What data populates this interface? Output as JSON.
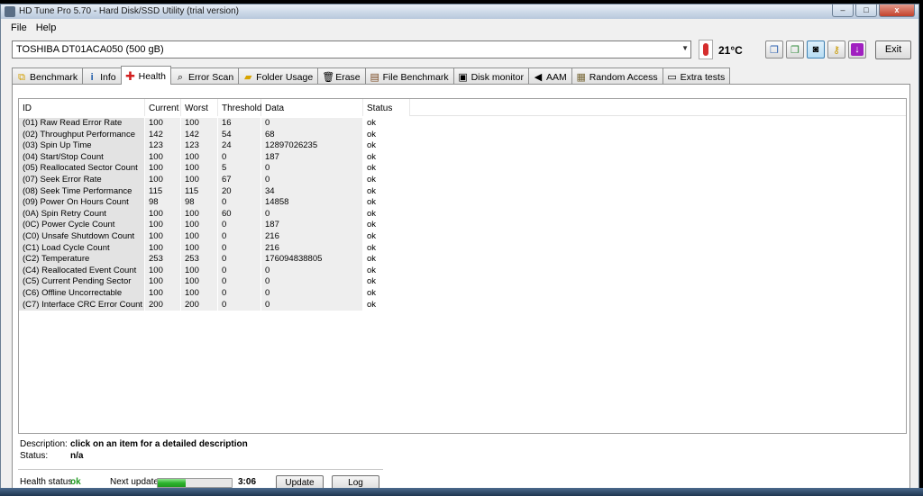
{
  "window": {
    "title": "HD Tune Pro 5.70 - Hard Disk/SSD Utility (trial version)",
    "controls": {
      "minimize": "–",
      "maximize": "□",
      "close": "x"
    }
  },
  "menu": [
    {
      "label": "File"
    },
    {
      "label": "Help"
    }
  ],
  "toolbar": {
    "drive": "TOSHIBA DT01ACA050 (500 gB)",
    "temperature": "21°C",
    "exit_label": "Exit",
    "icons": [
      "copy-text-icon",
      "copy-screenshot-icon",
      "camera-icon",
      "keys-icon",
      "save-down-icon"
    ]
  },
  "tabs": [
    {
      "label": "Benchmark",
      "icon": "benchmark-icon"
    },
    {
      "label": "Info",
      "icon": "info-icon"
    },
    {
      "label": "Health",
      "icon": "health-cross-icon",
      "active": true
    },
    {
      "label": "Error Scan",
      "icon": "magnifier-icon"
    },
    {
      "label": "Folder Usage",
      "icon": "folder-icon"
    },
    {
      "label": "Erase",
      "icon": "trash-icon"
    },
    {
      "label": "File Benchmark",
      "icon": "file-icon"
    },
    {
      "label": "Disk monitor",
      "icon": "monitor-icon"
    },
    {
      "label": "AAM",
      "icon": "speaker-icon"
    },
    {
      "label": "Random Access",
      "icon": "grid-icon"
    },
    {
      "label": "Extra tests",
      "icon": "window-icon"
    }
  ],
  "health_table": {
    "columns": [
      "ID",
      "Current",
      "Worst",
      "Threshold",
      "Data",
      "Status"
    ],
    "rows": [
      [
        "(01) Raw Read Error Rate",
        "100",
        "100",
        "16",
        "0",
        "ok"
      ],
      [
        "(02) Throughput Performance",
        "142",
        "142",
        "54",
        "68",
        "ok"
      ],
      [
        "(03) Spin Up Time",
        "123",
        "123",
        "24",
        "12897026235",
        "ok"
      ],
      [
        "(04) Start/Stop Count",
        "100",
        "100",
        "0",
        "187",
        "ok"
      ],
      [
        "(05) Reallocated Sector Count",
        "100",
        "100",
        "5",
        "0",
        "ok"
      ],
      [
        "(07) Seek Error Rate",
        "100",
        "100",
        "67",
        "0",
        "ok"
      ],
      [
        "(08) Seek Time Performance",
        "115",
        "115",
        "20",
        "34",
        "ok"
      ],
      [
        "(09) Power On Hours Count",
        "98",
        "98",
        "0",
        "14858",
        "ok"
      ],
      [
        "(0A) Spin Retry Count",
        "100",
        "100",
        "60",
        "0",
        "ok"
      ],
      [
        "(0C) Power Cycle Count",
        "100",
        "100",
        "0",
        "187",
        "ok"
      ],
      [
        "(C0) Unsafe Shutdown Count",
        "100",
        "100",
        "0",
        "216",
        "ok"
      ],
      [
        "(C1) Load Cycle Count",
        "100",
        "100",
        "0",
        "216",
        "ok"
      ],
      [
        "(C2) Temperature",
        "253",
        "253",
        "0",
        "176094838805",
        "ok"
      ],
      [
        "(C4) Reallocated Event Count",
        "100",
        "100",
        "0",
        "0",
        "ok"
      ],
      [
        "(C5) Current Pending Sector",
        "100",
        "100",
        "0",
        "0",
        "ok"
      ],
      [
        "(C6) Offline Uncorrectable",
        "100",
        "100",
        "0",
        "0",
        "ok"
      ],
      [
        "(C7) Interface CRC Error Count",
        "200",
        "200",
        "0",
        "0",
        "ok"
      ]
    ]
  },
  "description": {
    "label": "Description:",
    "value": "click on an item for a detailed description",
    "status_label": "Status:",
    "status_value": "n/a"
  },
  "health": {
    "label": "Health status:",
    "value": "ok",
    "value_color": "#1e9a1e",
    "next_update_label": "Next update:",
    "progress_fraction": 0.38,
    "countdown": "3:06",
    "update_button": "Update",
    "log_button": "Log"
  }
}
